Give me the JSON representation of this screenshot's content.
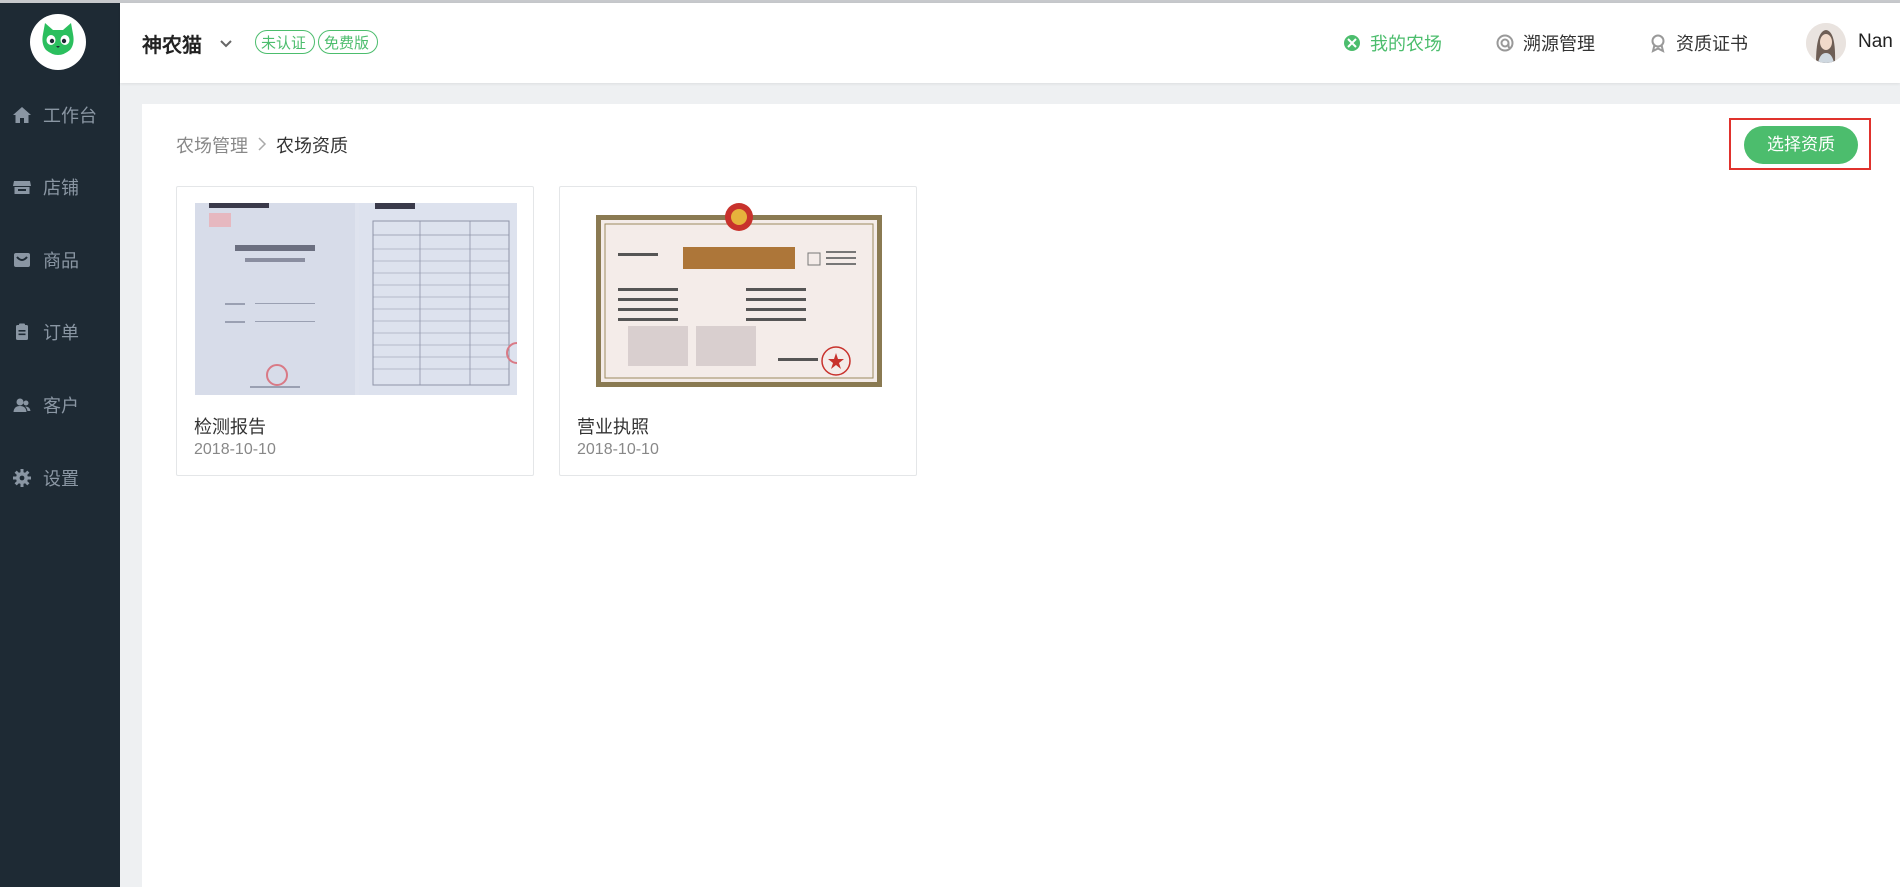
{
  "app": {
    "brand": "神农猫",
    "tags": [
      "未认证",
      "免费版"
    ]
  },
  "sidebar": {
    "items": [
      {
        "label": "工作台",
        "icon": "home-icon"
      },
      {
        "label": "店铺",
        "icon": "store-icon"
      },
      {
        "label": "商品",
        "icon": "goods-icon"
      },
      {
        "label": "订单",
        "icon": "order-icon"
      },
      {
        "label": "客户",
        "icon": "customer-icon"
      },
      {
        "label": "设置",
        "icon": "gear-icon"
      }
    ]
  },
  "header": {
    "nav": [
      {
        "label": "我的农场",
        "icon": "farm-icon",
        "active": true
      },
      {
        "label": "溯源管理",
        "icon": "trace-icon",
        "active": false
      },
      {
        "label": "资质证书",
        "icon": "certificate-icon",
        "active": false
      }
    ],
    "user": {
      "name": "Nan"
    }
  },
  "breadcrumb": {
    "parent": "农场管理",
    "separator": ">",
    "current": "农场资质"
  },
  "actions": {
    "select_label": "选择资质"
  },
  "cards": [
    {
      "title": "检测报告",
      "date": "2018-10-10"
    },
    {
      "title": "营业执照",
      "date": "2018-10-10"
    }
  ],
  "colors": {
    "accent": "#4cbd6d",
    "sidebar_bg": "#1e2a34",
    "highlight_border": "#e0322d"
  }
}
